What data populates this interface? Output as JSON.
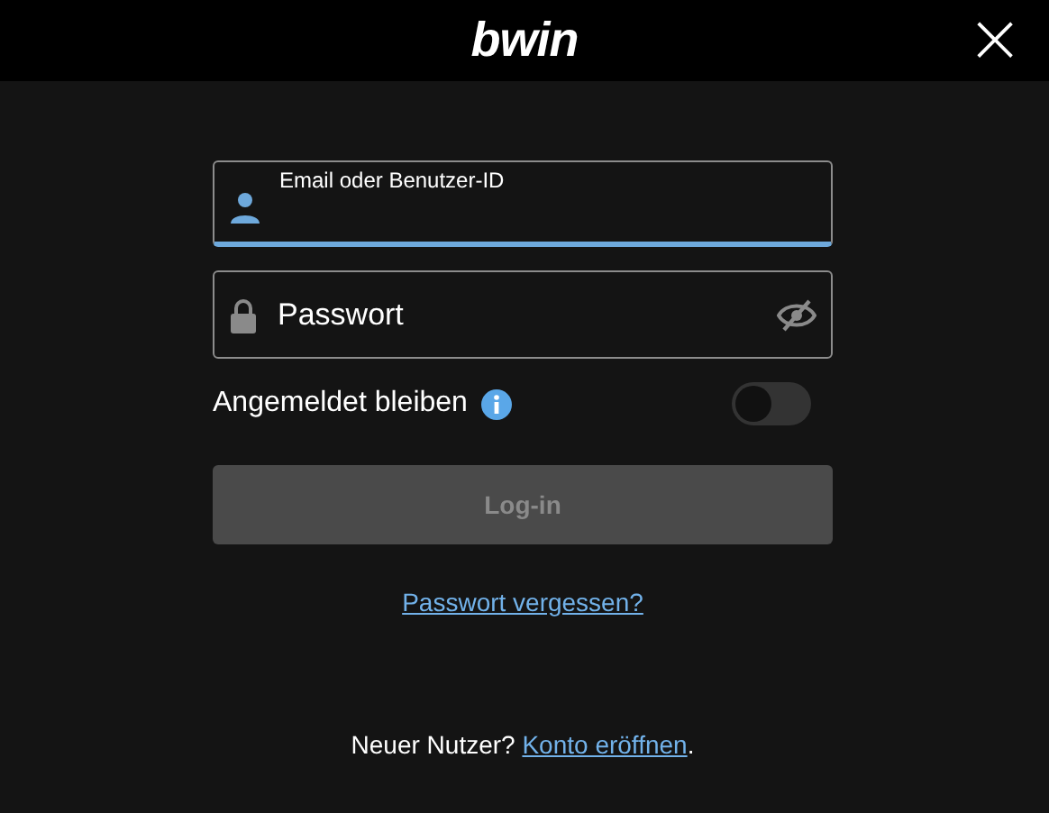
{
  "header": {
    "logo": "bwin",
    "close": "×"
  },
  "email_field": {
    "label": "Email oder Benutzer-ID",
    "focused": true
  },
  "password_field": {
    "placeholder": "Passwort",
    "visible": false
  },
  "stay_logged_in": {
    "label": "Angemeldet bleiben",
    "on": false
  },
  "login_button": {
    "label": "Log-in",
    "disabled": true
  },
  "forgot_link": "Passwort vergessen?",
  "register": {
    "prompt": "Neuer Nutzer?",
    "link": "Konto eröffnen",
    "end": "."
  }
}
